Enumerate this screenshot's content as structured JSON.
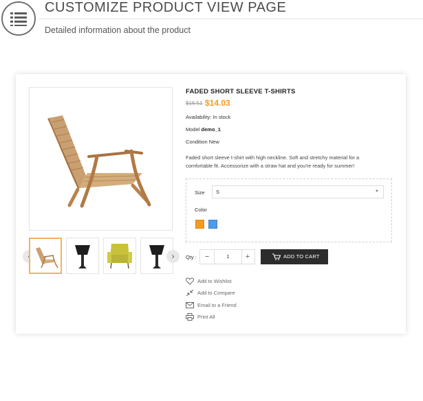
{
  "header": {
    "title": "CUSTOMIZE PRODUCT VIEW PAGE",
    "subtitle": "Detailed information about the product"
  },
  "product": {
    "name": "FADED SHORT SLEEVE T-SHIRTS",
    "old_price": "$16.51",
    "price": "$14.03",
    "availability_label": "Availability:",
    "availability_value": "In stock",
    "model_label": "Model",
    "model_value": "demo_1",
    "condition_label": "Condition",
    "condition_value": "New",
    "description": "Faded short sleeve t-shirt with high neckline. Soft and stretchy material for a comfortable fit. Accessorize with a straw hat and you're ready for summer!"
  },
  "options": {
    "size_label": "Size",
    "size_value": "S",
    "color_label": "Color",
    "colors": [
      "#f39c1d",
      "#4f9be8"
    ]
  },
  "purchase": {
    "qty_label": "Qty :",
    "qty_value": "1",
    "add_to_cart": "ADD TO CART"
  },
  "actions": {
    "wishlist": "Add to Wishlist",
    "compare": "Add to Compare",
    "email": "Email to a Friend",
    "print": "Print All"
  },
  "colors": {
    "price_accent": "#f39c23",
    "cart_button": "#2c2c2c",
    "active_thumb_border": "#f4b25b"
  },
  "icons": [
    "list-icon",
    "chair-image",
    "lamp-image",
    "armchair-image",
    "heart-icon",
    "compare-icon",
    "mail-icon",
    "print-icon",
    "cart-icon",
    "chevron-left-icon",
    "chevron-right-icon"
  ]
}
